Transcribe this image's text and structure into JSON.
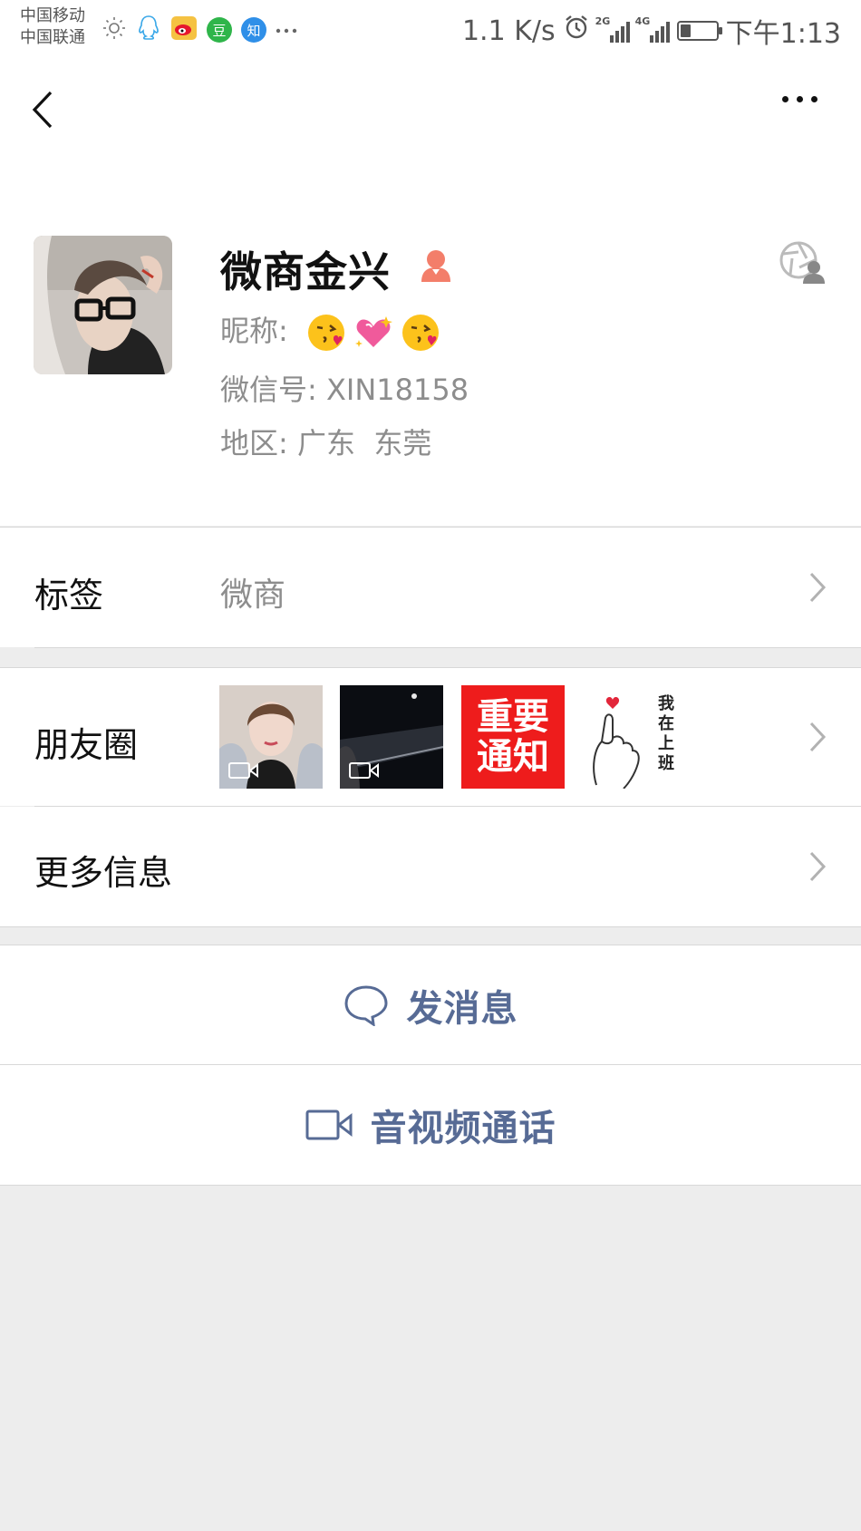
{
  "status_bar": {
    "carrier_1": "中国移动",
    "carrier_2": "中国联通",
    "speed": "1.1 K/s",
    "net_1": "2G",
    "net_2": "4G",
    "battery_level": 0.3,
    "time": "下午1:13",
    "notification_icons": [
      "brightness-icon",
      "qq-icon",
      "weibo-icon",
      "douban-icon",
      "zhihu-icon",
      "more-dots-icon"
    ],
    "douban_label": "豆",
    "zhihu_label": "知"
  },
  "profile": {
    "name": "微商金兴",
    "nickname_label": "昵称:",
    "nickname_emojis": [
      "kiss-emoji",
      "sparkling-heart-emoji",
      "kiss-emoji"
    ],
    "wechat_id_label": "微信号:",
    "wechat_id": "XIN18158",
    "region_label": "地区:",
    "region": "广东  东莞"
  },
  "rows": {
    "tags_label": "标签",
    "tags_value": "微商",
    "moments_label": "朋友圈",
    "moments_thumb_text_1": "重要",
    "moments_thumb_text_2": "通知",
    "moments_thumb_4_text": "我在上班",
    "more_info_label": "更多信息"
  },
  "actions": {
    "send_message": "发消息",
    "video_call": "音视频通话"
  },
  "colors": {
    "link_blue": "#576b95",
    "gender_female": "#f37e6a",
    "background": "#ededed"
  }
}
